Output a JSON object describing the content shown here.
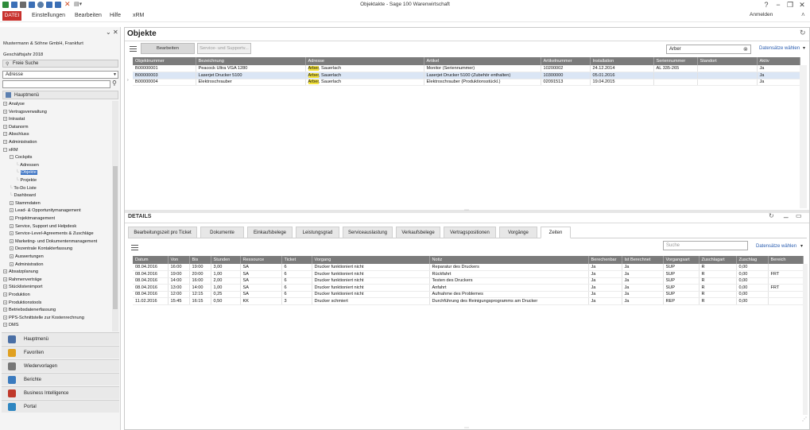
{
  "window": {
    "title": "Objektakte - Sage 100 Warenwirtschaft",
    "controls": [
      "?",
      "−",
      "❐",
      "✕"
    ]
  },
  "menu": {
    "datei": "DATEI",
    "items": [
      "Einstellungen",
      "Bearbeiten",
      "Hilfe",
      "xRM"
    ],
    "user": "Anmelden"
  },
  "left": {
    "company": "Mustermann & Söhne GmbH, Frankfurt",
    "fiscal_year": "Geschäftsjahr 2018",
    "freesearch_label": "Freie Suche",
    "category_value": "Adresse",
    "search_value": "",
    "hauptmenu_header": "Hauptmenü",
    "tree": [
      {
        "label": "Analyse",
        "level": 0,
        "sign": "+"
      },
      {
        "label": "Vertragsverwaltung",
        "level": 0,
        "sign": "+"
      },
      {
        "label": "Intrastat",
        "level": 0,
        "sign": "+"
      },
      {
        "label": "Datanorm",
        "level": 0,
        "sign": "+"
      },
      {
        "label": "Abschluss",
        "level": 0,
        "sign": "+"
      },
      {
        "label": "Administration",
        "level": 0,
        "sign": "+"
      },
      {
        "label": "xRM",
        "level": 0,
        "sign": "−"
      },
      {
        "label": "Cockpits",
        "level": 1,
        "sign": "−"
      },
      {
        "label": "Adressen",
        "level": 2,
        "sign": ""
      },
      {
        "label": "Objekte",
        "level": 2,
        "sign": "",
        "selected": true
      },
      {
        "label": "Projekte",
        "level": 2,
        "sign": ""
      },
      {
        "label": "To-Do Liste",
        "level": 1,
        "sign": ""
      },
      {
        "label": "Dashboard",
        "level": 1,
        "sign": ""
      },
      {
        "label": "Stammdaten",
        "level": 1,
        "sign": "+"
      },
      {
        "label": "Lead- & Opportunitymanagement",
        "level": 1,
        "sign": "+"
      },
      {
        "label": "Projektmanagement",
        "level": 1,
        "sign": "+"
      },
      {
        "label": "Service, Support und Helpdesk",
        "level": 1,
        "sign": "+"
      },
      {
        "label": "Service-Level-Agreements & Zuschläge",
        "level": 1,
        "sign": "+"
      },
      {
        "label": "Marketing- und Dokumentenmanagement",
        "level": 1,
        "sign": "+"
      },
      {
        "label": "Dezentrale Kontakterfassung",
        "level": 1,
        "sign": "+"
      },
      {
        "label": "Auswertungen",
        "level": 1,
        "sign": "+"
      },
      {
        "label": "Administration",
        "level": 1,
        "sign": "+"
      },
      {
        "label": "Absatzplanung",
        "level": 0,
        "sign": "+"
      },
      {
        "label": "Rahmenverträge",
        "level": 0,
        "sign": "+"
      },
      {
        "label": "Stücklistenimport",
        "level": 0,
        "sign": "+"
      },
      {
        "label": "Produktion",
        "level": 0,
        "sign": "+"
      },
      {
        "label": "Produktionstools",
        "level": 0,
        "sign": "+"
      },
      {
        "label": "Betriebsdatenerfassung",
        "level": 0,
        "sign": "+"
      },
      {
        "label": "PPS-Schnittstelle zur Kostenrechnung",
        "level": 0,
        "sign": "+"
      },
      {
        "label": "DMS",
        "level": 0,
        "sign": "+"
      }
    ],
    "nav": [
      {
        "label": "Hauptmenü",
        "icon": "list-icon",
        "color": "#4a6fa5"
      },
      {
        "label": "Favoriten",
        "icon": "star-icon",
        "color": "#e0a020"
      },
      {
        "label": "Wiedervorlagen",
        "icon": "paperclip-icon",
        "color": "#777777"
      },
      {
        "label": "Berichte",
        "icon": "report-icon",
        "color": "#3b7bbf"
      },
      {
        "label": "Business Intelligence",
        "icon": "chart-icon",
        "color": "#c0392b"
      },
      {
        "label": "Portal",
        "icon": "globe-icon",
        "color": "#2e86c1"
      }
    ]
  },
  "objekte": {
    "title": "Objekte",
    "btn_edit": "Bearbeiten",
    "btn_service": "Service- und Supportv...",
    "search_value": "Arber",
    "datasets_link": "Datensätze wählen",
    "columns": [
      "Objektnummer",
      "Bezeichnung",
      "Adresse",
      "Artikel",
      "Artikelnummer",
      "Installation",
      "Seriennummer",
      "Standort",
      "Aktiv"
    ],
    "rows": [
      [
        "B00000001",
        "Peacock Ultra VGA 1280",
        "Arber, Sauerlach",
        "Monitor (Seriennummer)",
        "10200002",
        "24.12.2014",
        "AL 335-265",
        "",
        "Ja"
      ],
      [
        "B00000003",
        "Laserjet Drucker 5100",
        "Arber, Sauerlach",
        "Laserjet Drucker 5100 (Zubehör enthalten)",
        "10300000",
        "05.01.2016",
        "",
        "",
        "Ja"
      ],
      [
        "B00000004",
        "Elektroschrauber",
        "Arber, Sauerlach",
        "Elektroschrauber (Produktionsstückl.)",
        "02091513",
        "19.04.2015",
        "",
        "",
        "Ja"
      ]
    ],
    "highlight": "Arber"
  },
  "details": {
    "title": "DETAILS",
    "tabs": [
      "Bearbeitungszeit pro Ticket",
      "Dokumente",
      "Einkaufsbelege",
      "Leistungsgrad",
      "Serviceauslastung",
      "Verkaufsbelege",
      "Vertragspositionen",
      "Vorgänge",
      "Zeiten"
    ],
    "active_tab": "Zeiten",
    "search_placeholder": "Suche",
    "datasets_link": "Datensätze wählen",
    "columns": [
      "Datum",
      "Von",
      "Bis",
      "Stunden",
      "Ressource",
      "Ticket",
      "Vorgang",
      "Notiz",
      "Berechenbar",
      "Ist Berechnet",
      "Vorgangsart",
      "Zuschlagart",
      "Zuschlag",
      "Bereich"
    ],
    "rows": [
      [
        "08.04.2016",
        "16:00",
        "19:00",
        "3,00",
        "SA",
        "6",
        "Drucker funktioniert nicht",
        "Reparatur des Druckers",
        "Ja",
        "Ja",
        "SUP",
        "R",
        "0,00",
        ""
      ],
      [
        "08.04.2016",
        "19:00",
        "20:00",
        "1,00",
        "SA",
        "6",
        "Drucker funktioniert nicht",
        "Rückfahrt",
        "Ja",
        "Ja",
        "SUP",
        "R",
        "0,00",
        "FRT"
      ],
      [
        "08.04.2016",
        "14:00",
        "16:00",
        "2,00",
        "SA",
        "6",
        "Drucker funktioniert nicht",
        "Testen des Druckers",
        "Ja",
        "Ja",
        "SUP",
        "R",
        "0,00",
        ""
      ],
      [
        "08.04.2016",
        "13:00",
        "14:00",
        "1,00",
        "SA",
        "6",
        "Drucker funktioniert nicht",
        "Anfahrt",
        "Ja",
        "Ja",
        "SUP",
        "R",
        "0,00",
        "FRT"
      ],
      [
        "08.04.2016",
        "12:00",
        "12:15",
        "0,25",
        "SA",
        "6",
        "Drucker funktioniert nicht",
        "Aufnahme des Problemes",
        "Ja",
        "Ja",
        "SUP",
        "R",
        "0,00",
        ""
      ],
      [
        "11.02.2016",
        "15:45",
        "16:15",
        "0,50",
        "KK",
        "3",
        "Drucker schmiert",
        "Durchführung des Reinigungsprogramms am Drucker",
        "Ja",
        "Ja",
        "REP",
        "R",
        "0,00",
        ""
      ]
    ]
  }
}
